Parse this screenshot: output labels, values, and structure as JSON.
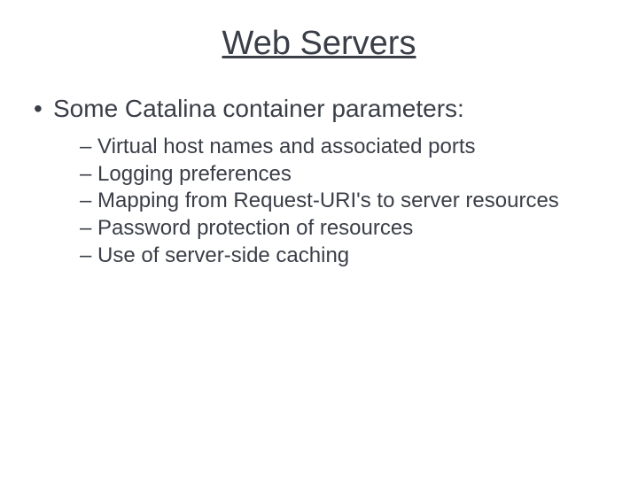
{
  "title": "Web Servers",
  "bullet": {
    "marker": "•",
    "text": "Some Catalina container parameters:"
  },
  "sub": {
    "dash": "–",
    "items": [
      "Virtual host names and associated ports",
      "Logging preferences",
      "Mapping from Request-URI's to server resources",
      "Password protection of resources",
      "Use of server-side caching"
    ]
  }
}
